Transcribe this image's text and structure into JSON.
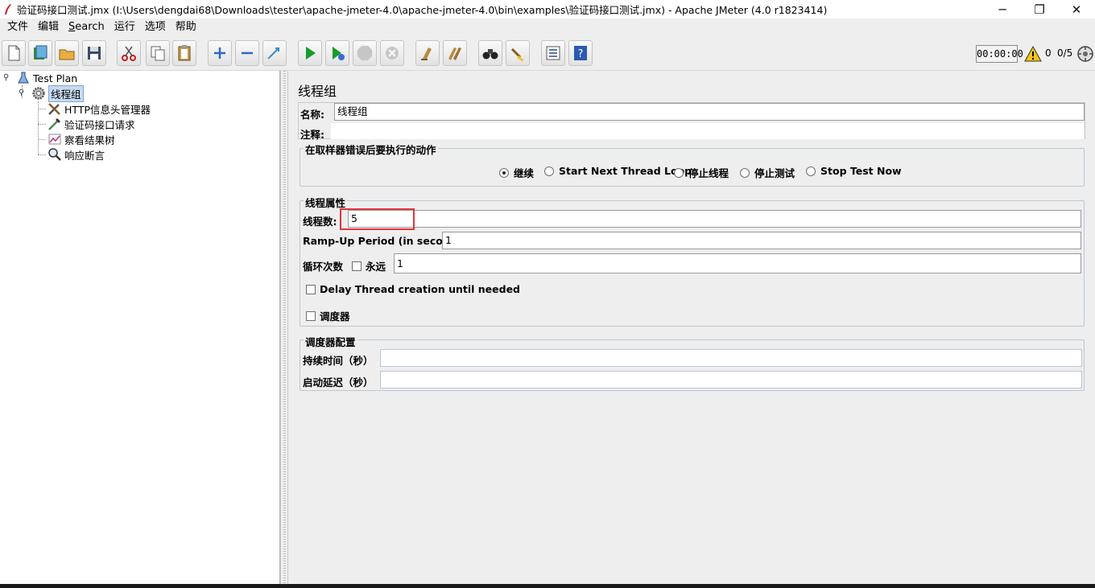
{
  "window": {
    "title": "验证码接口测试.jmx (I:\\Users\\dengdai68\\Downloads\\tester\\apache-jmeter-4.0\\apache-jmeter-4.0\\bin\\examples\\验证码接口测试.jmx) - Apache JMeter (4.0 r1823414)",
    "minimize": "─",
    "maximize": "❐",
    "close": "✕"
  },
  "menu": {
    "items": [
      "文件",
      "编辑",
      "Search",
      "运行",
      "选项",
      "帮助"
    ]
  },
  "toolbar": {
    "icons": [
      "new-icon",
      "templates-icon",
      "open-icon",
      "save-icon",
      "cut-icon",
      "copy-icon",
      "paste-icon",
      "expand-icon",
      "collapse-icon",
      "toggle-icon",
      "start-icon",
      "start-no-pause-icon",
      "stop-icon",
      "shutdown-icon",
      "clear-icon",
      "clear-all-icon",
      "search-icon",
      "reset-search-icon",
      "function-helper-icon",
      "help-icon"
    ],
    "timer": "00:00:00",
    "error_count": "0",
    "active_threads": "0/5"
  },
  "tree": {
    "nodes": [
      {
        "label": "Test Plan",
        "icon": "test-plan-icon"
      },
      {
        "label": "线程组",
        "icon": "thread-group-gear-icon"
      },
      {
        "label": "HTTP信息头管理器",
        "icon": "header-manager-tools-icon"
      },
      {
        "label": "验证码接口请求",
        "icon": "sampler-pipette-icon"
      },
      {
        "label": "察看结果树",
        "icon": "listener-chart-icon"
      },
      {
        "label": "响应断言",
        "icon": "assertion-magnifier-icon"
      }
    ]
  },
  "thread_group": {
    "title": "线程组",
    "name_label": "名称:",
    "name_value": "线程组",
    "comment_label": "注释:",
    "comment_value": "",
    "on_error": {
      "legend": "在取样器错误后要执行的动作",
      "options": [
        "继续",
        "Start Next Thread Loop",
        "停止线程",
        "停止测试",
        "Stop Test Now"
      ],
      "selected": "继续"
    },
    "props": {
      "legend": "线程属性",
      "threads_label": "线程数:",
      "threads_value": "5",
      "rampup_label": "Ramp-Up Period (in seconds):",
      "rampup_value": "1",
      "loop_label": "循环次数",
      "forever_label": "永远",
      "loop_value": "1",
      "delay_label": "Delay Thread creation until needed",
      "scheduler_label": "调度器"
    },
    "scheduler": {
      "legend": "调度器配置",
      "duration_label": "持续时间（秒）",
      "duration_value": "",
      "startup_delay_label": "启动延迟（秒）",
      "startup_delay_value": ""
    }
  }
}
